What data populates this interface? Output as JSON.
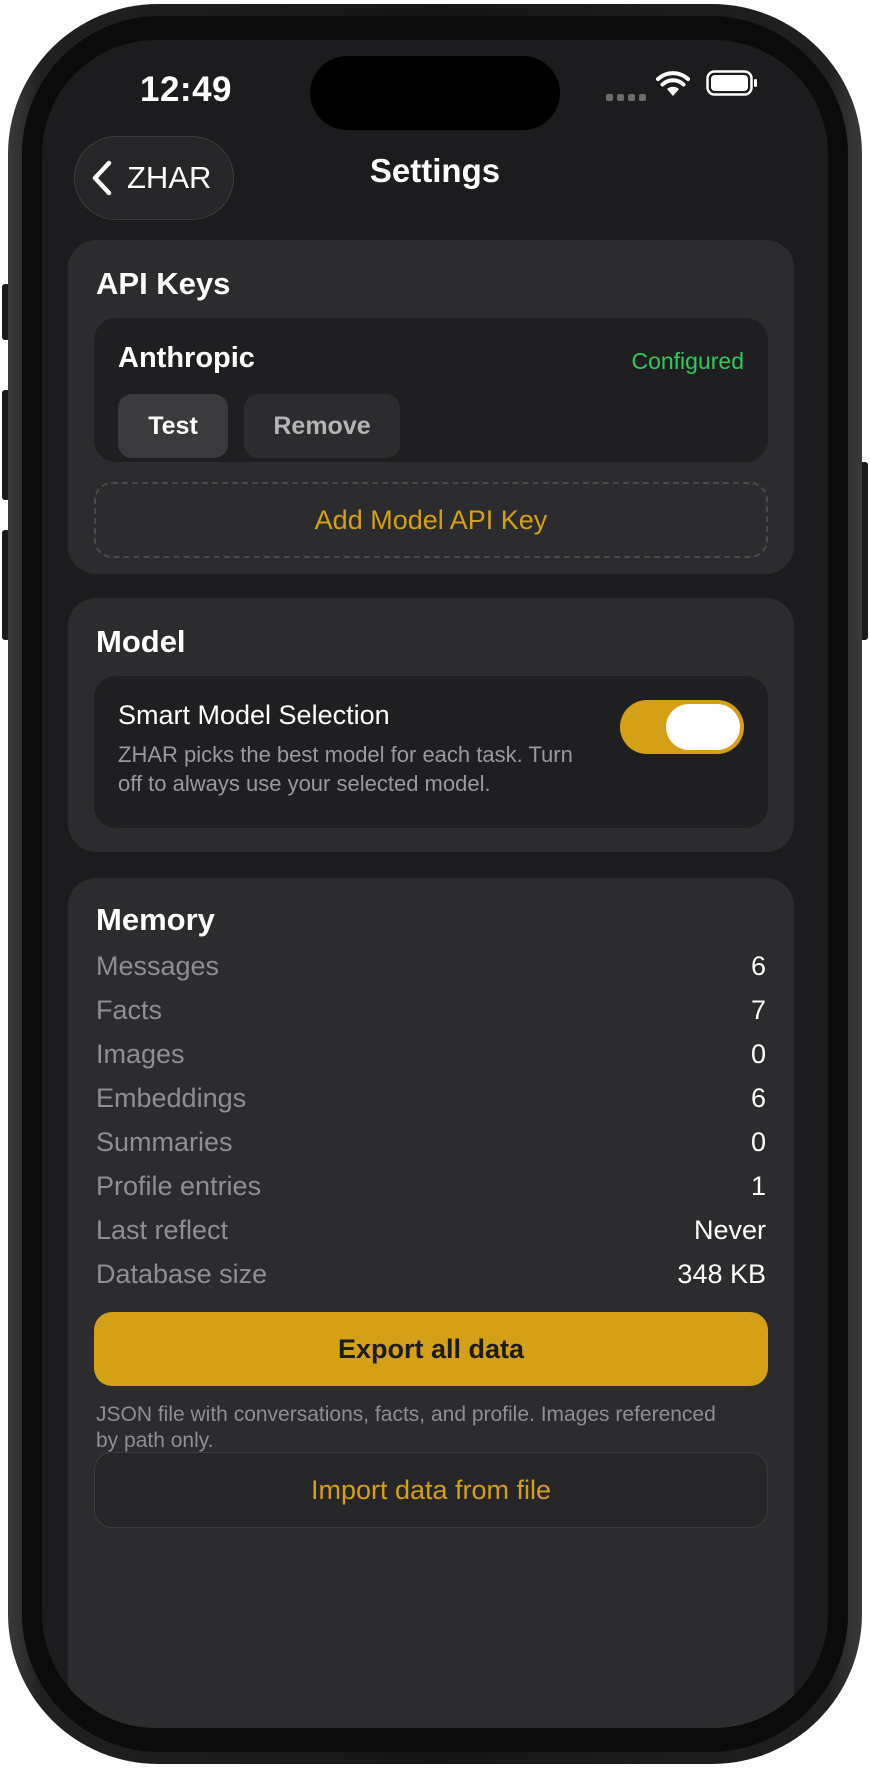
{
  "status_bar": {
    "time": "12:49"
  },
  "nav": {
    "back_label": "ZHAR",
    "title": "Settings"
  },
  "api_keys": {
    "title": "API Keys",
    "provider": {
      "name": "Anthropic",
      "status": "Configured",
      "test_label": "Test",
      "remove_label": "Remove"
    },
    "add_label": "Add Model API Key"
  },
  "model": {
    "title": "Model",
    "smart_selection": {
      "title": "Smart Model Selection",
      "description": "ZHAR picks the best model for each task. Turn off to always use your selected model.",
      "enabled": true
    }
  },
  "memory": {
    "title": "Memory",
    "stats": [
      {
        "label": "Messages",
        "value": "6"
      },
      {
        "label": "Facts",
        "value": "7"
      },
      {
        "label": "Images",
        "value": "0"
      },
      {
        "label": "Embeddings",
        "value": "6"
      },
      {
        "label": "Summaries",
        "value": "0"
      },
      {
        "label": "Profile entries",
        "value": "1"
      },
      {
        "label": "Last reflect",
        "value": "Never"
      },
      {
        "label": "Database size",
        "value": "348 KB"
      }
    ],
    "export_label": "Export all data",
    "export_note": "JSON file with conversations, facts, and profile. Images referenced by path only.",
    "import_label": "Import data from file"
  },
  "colors": {
    "accent": "#d4a017",
    "success": "#34c759",
    "background": "#1c1c1e",
    "card": "#2c2c2e"
  }
}
